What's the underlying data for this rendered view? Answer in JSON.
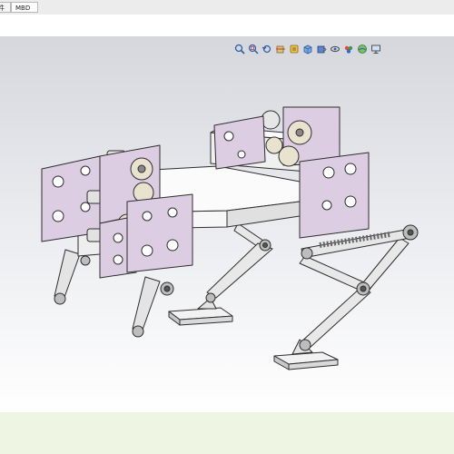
{
  "tabs": {
    "parts_label": "件",
    "mbd_label": "MBD"
  },
  "toolbar": {
    "icons": [
      "zoom-to-fit-icon",
      "zoom-area-icon",
      "previous-view-icon",
      "section-view-icon",
      "dynamic-annotation-icon",
      "view-orientation-icon",
      "display-style-icon",
      "hide-show-icon",
      "edit-appearance-icon",
      "scene-icon",
      "monitor-icon"
    ]
  },
  "colors": {
    "plate": "#dccde2",
    "plate_edge": "#3a3a3a",
    "steel": "#d8d8d8",
    "viewport_top": "#d6d7dc",
    "footer": "#eef5e2"
  }
}
